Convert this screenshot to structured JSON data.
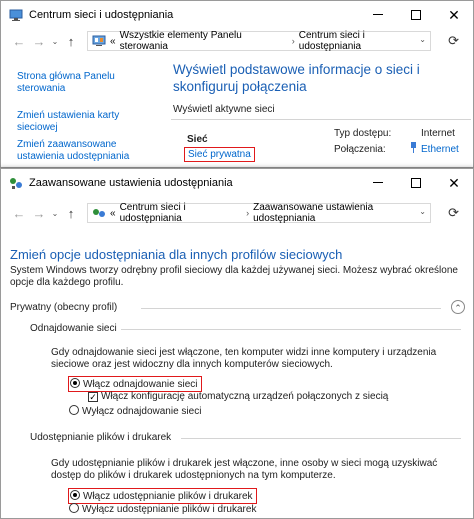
{
  "window1": {
    "title": "Centrum sieci i udostępniania",
    "address": {
      "prefix": "«",
      "segments": [
        "Wszystkie elementy Panelu sterowania",
        "Centrum sieci i udostępniania"
      ]
    },
    "sidebar": [
      {
        "label": "Strona główna Panelu sterowania"
      },
      {
        "label": "Zmień ustawienia karty sieciowej"
      },
      {
        "label": "Zmień zaawansowane ustawienia udostępniania"
      }
    ],
    "heading": "Wyświetl podstawowe informacje o sieci i skonfiguruj połączenia",
    "section_label": "Wyświetl aktywne sieci",
    "network_name": "Sieć",
    "network_type": "Sieć prywatna",
    "access_type_label": "Typ dostępu:",
    "access_type_value": "Internet",
    "connections_label": "Połączenia:",
    "connections_value": "Ethernet"
  },
  "window2": {
    "title": "Zaawansowane ustawienia udostępniania",
    "address": {
      "prefix": "«",
      "segments": [
        "Centrum sieci i udostępniania",
        "Zaawansowane ustawienia udostępniania"
      ]
    },
    "heading": "Zmień opcje udostępniania dla innych profilów sieciowych",
    "intro": "System Windows tworzy odrębny profil sieciowy dla każdej używanej sieci. Możesz wybrać określone opcje dla każdego profilu.",
    "profile_label": "Prywatny (obecny profil)",
    "discovery": {
      "title": "Odnajdowanie sieci",
      "description": "Gdy odnajdowanie sieci jest włączone, ten komputer widzi inne komputery i urządzenia sieciowe oraz jest widoczny dla innych komputerów sieciowych.",
      "on_label": "Włącz odnajdowanie sieci",
      "auto_label": "Włącz konfigurację automatyczną urządzeń połączonych z siecią",
      "off_label": "Wyłącz odnajdowanie sieci"
    },
    "sharing": {
      "title": "Udostępnianie plików i drukarek",
      "description": "Gdy udostępnianie plików i drukarek jest włączone, inne osoby w sieci mogą uzyskiwać dostęp do plików i drukarek udostępnionych na tym komputerze.",
      "on_label": "Włącz udostępnianie plików i drukarek",
      "off_label": "Wyłącz udostępnianie plików i drukarek"
    }
  },
  "controls": {
    "minimize": "—",
    "close": "✕",
    "back": "←",
    "forward": "→",
    "up": "↑",
    "dropdown": "⌄",
    "refresh": "⟳",
    "collapse": "⌃",
    "breadcrumb_sep": "›"
  },
  "colors": {
    "link": "#0066cc",
    "heading": "#1a5fb4",
    "highlight": "#e0191b"
  }
}
